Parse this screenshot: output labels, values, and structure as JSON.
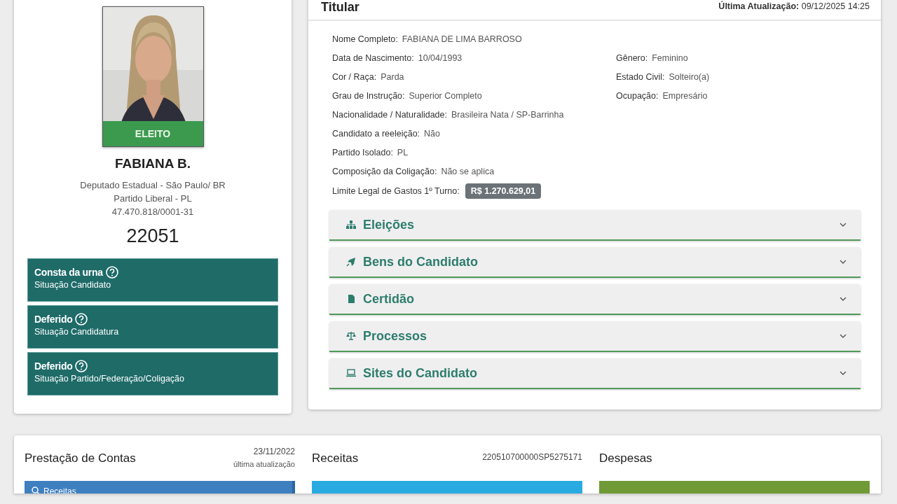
{
  "candidate_card": {
    "status_badge": "ELEITO",
    "name": "FABIANA B.",
    "details": [
      "Deputado Estadual - São Paulo/ BR",
      "Partido Liberal - PL",
      "47.470.818/0001-31"
    ],
    "number": "22051",
    "situations": [
      {
        "value": "Consta da urna",
        "label": "Situação Candidato"
      },
      {
        "value": "Deferido",
        "label": "Situação Candidatura"
      },
      {
        "value": "Deferido",
        "label": "Situação Partido/Federação/Coligação"
      }
    ]
  },
  "titular": {
    "title": "Titular",
    "last_update_label": "Última Atualização:",
    "last_update": "09/12/2025 14:25",
    "rows": [
      [
        {
          "label": "Nome Completo:",
          "value": "FABIANA DE LIMA BARROSO"
        }
      ],
      [
        {
          "label": "Data de Nascimento:",
          "value": "10/04/1993"
        },
        {
          "label": "Gênero:",
          "value": "Feminino"
        }
      ],
      [
        {
          "label": "Cor / Raça:",
          "value": "Parda"
        },
        {
          "label": "Estado Civil:",
          "value": "Solteiro(a)"
        }
      ],
      [
        {
          "label": "Grau de Instrução:",
          "value": "Superior Completo"
        },
        {
          "label": "Ocupação:",
          "value": "Empresário"
        }
      ],
      [
        {
          "label": "Nacionalidade / Naturalidade:",
          "value": "Brasileira Nata / SP-Barrinha"
        }
      ],
      [
        {
          "label": "Candidato a reeleição:",
          "value": "Não"
        }
      ],
      [
        {
          "label": "Partido Isolado:",
          "value": "PL"
        }
      ],
      [
        {
          "label": "Composição da Coligação:",
          "value": "Não se aplica"
        }
      ]
    ],
    "spending_limit": {
      "label": "Limite Legal de Gastos 1º Turno:",
      "value": "R$ 1.270.629,01"
    },
    "sections": [
      {
        "label": "Eleições",
        "expanded": false
      },
      {
        "label": "Bens do Candidato",
        "expanded": false
      },
      {
        "label": "Certidão",
        "expanded": false
      },
      {
        "label": "Processos",
        "expanded": false
      },
      {
        "label": "Sites do Candidato",
        "expanded": false
      }
    ]
  },
  "accounts": {
    "title": "Prestação de Contas",
    "date": "23/11/2022",
    "date_caption": "última atualização",
    "menu_item": "Receitas",
    "income": {
      "title": "Receitas",
      "code": "220510700000SP5275171"
    },
    "expenses": {
      "title": "Despesas"
    }
  }
}
